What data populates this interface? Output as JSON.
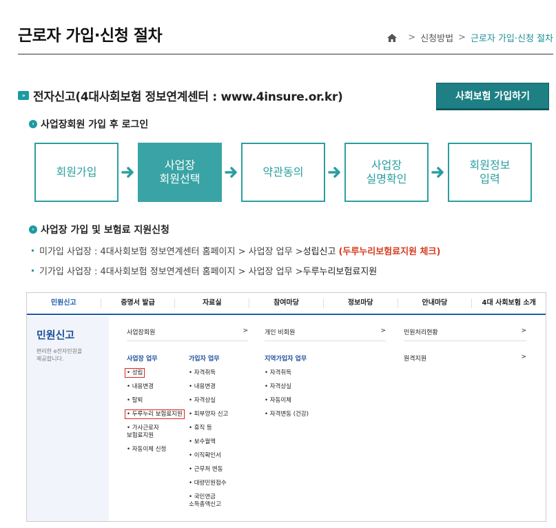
{
  "header": {
    "title": "근로자 가입·신청 절차",
    "breadcrumb": [
      "신청방법",
      "근로자 가입·신청 절차"
    ]
  },
  "section": {
    "title": "전자신고(4대사회보험 정보연계센터 : www.4insure.or.kr)",
    "join_button": "사회보험 가입하기",
    "sub1": "사업장회원 가입 후 로그인",
    "sub2": "사업장 가입 및 보험료 지원신청"
  },
  "steps": [
    {
      "label": "회원가입"
    },
    {
      "label": "사업장\n회원선택"
    },
    {
      "label": "약관동의"
    },
    {
      "label": "사업장\n실명확인"
    },
    {
      "label": "회원정보\n입력"
    }
  ],
  "list": [
    {
      "prefix": "미가입 사업장 : 4대사회보험 정보연계센터 홈페이지 > 사업장 업무 > ",
      "strong": "성립신고",
      "red": "(두루누리보험료지원 체크)"
    },
    {
      "prefix": "기가입 사업장 : 4대사회보험 정보연계센터 홈페이지 > 사업장 업무 > ",
      "strong": "두루누리보험료지원",
      "red": ""
    }
  ],
  "shot": {
    "nav": [
      "민원신고",
      "증명서 발급",
      "자료실",
      "참여마당",
      "정보마당",
      "안내마당",
      "4대 사회보험 소개"
    ],
    "side_title": "민원신고",
    "side_desc": "편리한 e전자민원을\n제공합니다.",
    "rows": [
      {
        "label": "사업장회원",
        "arrow": ">"
      },
      {
        "label": "개인 비회원",
        "arrow": ">"
      },
      {
        "label": "민원처리현황",
        "arrow": ">"
      },
      {
        "label": "원격지원",
        "arrow": ">"
      }
    ],
    "col1": {
      "title": "사업장 업무",
      "items": [
        "• 성립",
        "• 내용변경",
        "• 탈퇴",
        "• 두루누리 보험료지원",
        "• 가사근로자\n  보험료지원",
        "• 자동이체 신청"
      ]
    },
    "col2": {
      "title": "가입자 업무",
      "items": [
        "• 자격취득",
        "• 내용변경",
        "• 자격상실",
        "• 피부양자 신고",
        "• 휴직 등",
        "• 보수월액",
        "• 이직확인서",
        "• 근무처 변동",
        "• 대량민원접수",
        "• 국민연금\n  소득총액신고"
      ]
    },
    "col3": {
      "title": "지역가입자 업무",
      "items": [
        "• 자격취득",
        "• 자격상실",
        "• 자동이체",
        "• 자격변동 (건강)"
      ]
    }
  },
  "colors": {
    "accent": "#2a9ea0",
    "button": "#1e7f84",
    "highlight": "#d63b1f",
    "nav_blue": "#1c5ba8"
  }
}
